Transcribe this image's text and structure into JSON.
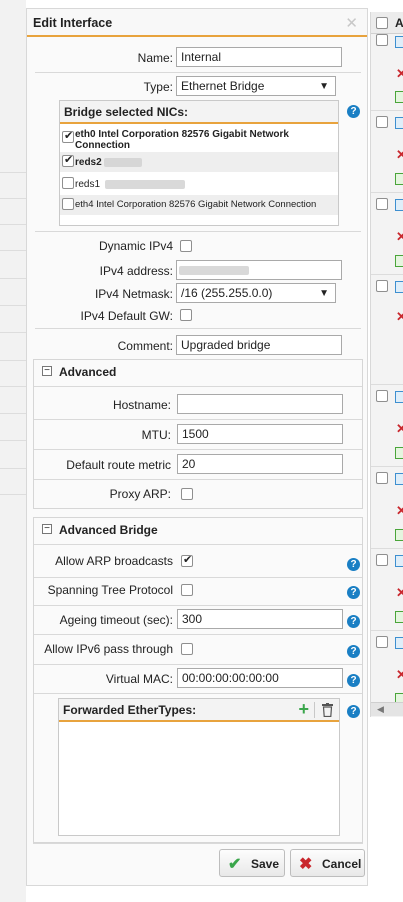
{
  "dialog": {
    "title": "Edit Interface",
    "close_glyph": "✕",
    "fields": {
      "name_label": "Name:",
      "name_value": "Internal",
      "type_label": "Type:",
      "type_value": "Ethernet Bridge",
      "dynamic_ipv4_label": "Dynamic IPv4",
      "dynamic_ipv4_checked": false,
      "ipv4_address_label": "IPv4 address:",
      "ipv4_netmask_label": "IPv4 Netmask:",
      "ipv4_netmask_value": "/16 (255.255.0.0)",
      "ipv4_default_gw_label": "IPv4 Default GW:",
      "ipv4_default_gw_checked": false,
      "comment_label": "Comment:",
      "comment_value": "Upgraded bridge"
    },
    "bridge_nics": {
      "title": "Bridge selected NICs:",
      "items": [
        {
          "label": "eth0 Intel Corporation 82576 Gigabit Network Connection",
          "checked": true
        },
        {
          "label": "reds2",
          "checked": true
        },
        {
          "label": "reds1",
          "checked": false
        },
        {
          "label": "eth4 Intel Corporation 82576 Gigabit Network Connection",
          "checked": false
        }
      ]
    },
    "advanced": {
      "title": "Advanced",
      "hostname_label": "Hostname:",
      "hostname_value": "",
      "mtu_label": "MTU:",
      "mtu_value": "1500",
      "metric_label": "Default route metric",
      "metric_value": "20",
      "proxy_arp_label": "Proxy ARP:",
      "proxy_arp_checked": false
    },
    "advanced_bridge": {
      "title": "Advanced Bridge",
      "allow_arp_label": "Allow ARP broadcasts",
      "allow_arp_checked": true,
      "stp_label": "Spanning Tree Protocol",
      "stp_checked": false,
      "ageing_label": "Ageing timeout (sec):",
      "ageing_value": "300",
      "ipv6_pass_label": "Allow IPv6 pass through",
      "ipv6_pass_checked": false,
      "virtual_mac_label": "Virtual MAC:",
      "virtual_mac_value": "00:00:00:00:00:00",
      "ethertypes_title": "Forwarded EtherTypes:"
    },
    "buttons": {
      "save_label": "Save",
      "cancel_label": "Cancel"
    }
  },
  "right_list": {
    "header_text": "A"
  },
  "colors": {
    "accent_orange": "#e8a33d",
    "help_blue": "#1a7fc4",
    "save_green": "#3aa64b",
    "cancel_red": "#c9272d"
  },
  "icons": [
    "close-icon",
    "help-icon",
    "minus-icon",
    "plus-icon",
    "trash-icon",
    "checkmark-icon",
    "cross-icon",
    "dropdown-arrow-icon"
  ]
}
